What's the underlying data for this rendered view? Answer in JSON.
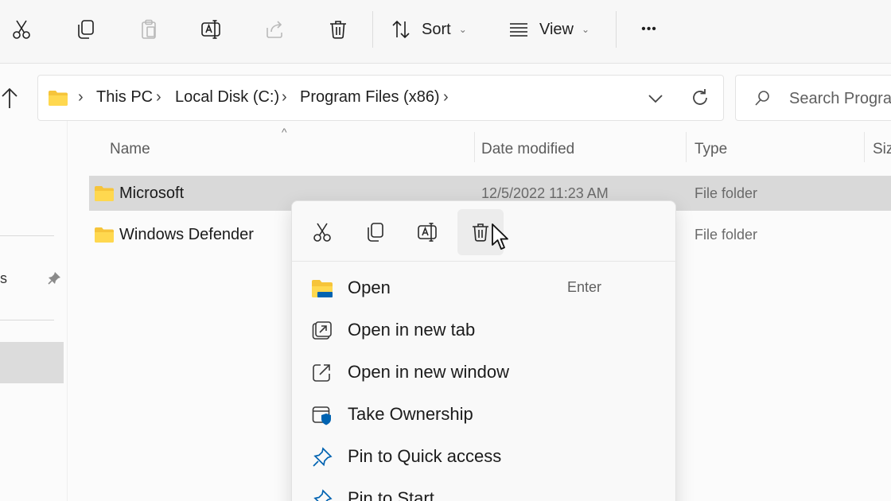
{
  "colors": {
    "folder": "#f6c43a",
    "folder_front": "#ffd84f",
    "accent_blue": "#0063b1",
    "selected_row": "#d9d9d9",
    "background": "#fbfbfb"
  },
  "command_bar": {
    "icons": [
      "cut-icon",
      "copy-icon",
      "paste-icon",
      "rename-icon",
      "share-icon",
      "delete-icon"
    ],
    "sort_label": "Sort",
    "view_label": "View",
    "more_label": "•••"
  },
  "address_bar": {
    "breadcrumbs": [
      "This PC",
      "Local Disk (C:)",
      "Program Files (x86)"
    ],
    "separator": "›"
  },
  "search": {
    "placeholder": "Search Program"
  },
  "nav_pane": {
    "partial_label": "s"
  },
  "file_list": {
    "columns": [
      "Name",
      "Date modified",
      "Type",
      "Siz"
    ],
    "sort_indicator": "^",
    "rows": [
      {
        "name": "Microsoft",
        "date": "12/5/2022 11:23 AM",
        "type": "File folder",
        "selected": true
      },
      {
        "name": "Windows Defender",
        "date": "",
        "type": "File folder",
        "selected": false
      }
    ]
  },
  "context_menu": {
    "quick_actions": [
      "cut-icon",
      "copy-icon",
      "rename-icon",
      "delete-icon"
    ],
    "items": [
      {
        "label": "Open",
        "shortcut": "Enter",
        "icon": "folder-open-icon"
      },
      {
        "label": "Open in new tab",
        "shortcut": "",
        "icon": "new-tab-icon"
      },
      {
        "label": "Open in new window",
        "shortcut": "",
        "icon": "new-window-icon"
      },
      {
        "label": "Take Ownership",
        "shortcut": "",
        "icon": "shield-icon"
      },
      {
        "label": "Pin to Quick access",
        "shortcut": "",
        "icon": "pin-icon"
      },
      {
        "label": "Pin to Start",
        "shortcut": "",
        "icon": "pin-start-icon"
      }
    ]
  }
}
